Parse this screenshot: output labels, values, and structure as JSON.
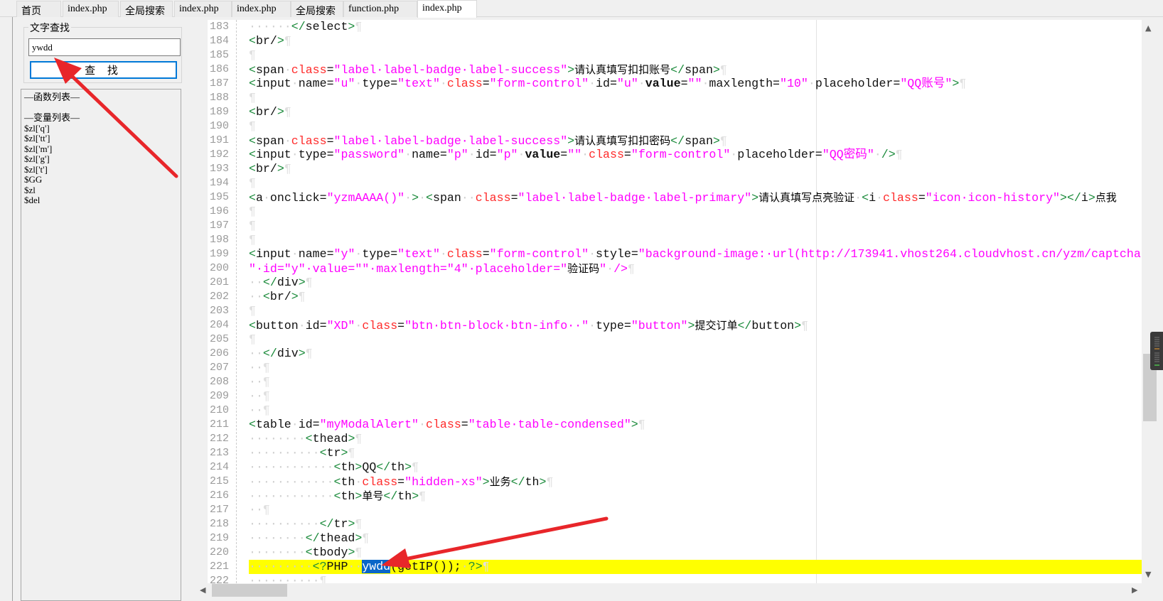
{
  "tabs": [
    {
      "label": "首页"
    },
    {
      "label": "index.php"
    },
    {
      "label": "全局搜索"
    },
    {
      "label": "index.php"
    },
    {
      "label": "index.php"
    },
    {
      "label": "全局搜索"
    },
    {
      "label": "function.php"
    },
    {
      "label": "index.php",
      "active": true
    }
  ],
  "find": {
    "legend": "文字查找",
    "value": "ywdd",
    "button": "查 找"
  },
  "list": [
    "—函数列表—",
    "",
    "—变量列表—",
    "$zl['q']",
    "$zl['tt']",
    "$zl['m']",
    "$zl['g']",
    "$zl['t']",
    "$GG",
    "$zl",
    "$del"
  ],
  "editor": {
    "highlight_line": 221,
    "lines": [
      {
        "n": "183",
        "t": [
          [
            "w",
            "······"
          ],
          [
            "p",
            "</"
          ],
          [
            "n",
            "select"
          ],
          [
            "p",
            ">"
          ],
          [
            "pil",
            "¶"
          ]
        ]
      },
      {
        "n": "184",
        "t": [
          [
            "p",
            "<"
          ],
          [
            "n",
            "br/"
          ],
          [
            "p",
            ">"
          ],
          [
            "pil",
            "¶"
          ]
        ]
      },
      {
        "n": "185",
        "t": [
          [
            "pil",
            "¶"
          ]
        ]
      },
      {
        "n": "186",
        "t": [
          [
            "p",
            "<"
          ],
          [
            "n",
            "span"
          ],
          [
            "w",
            "·"
          ],
          [
            "a",
            "class"
          ],
          [
            "n",
            "="
          ],
          [
            "s",
            "\"label·label-badge·label-success\""
          ],
          [
            "p",
            ">"
          ],
          [
            "c",
            "请认真填写扣扣账号"
          ],
          [
            "p",
            "</"
          ],
          [
            "n",
            "span"
          ],
          [
            "p",
            ">"
          ],
          [
            "pil",
            "¶"
          ]
        ]
      },
      {
        "n": "187",
        "t": [
          [
            "p",
            "<"
          ],
          [
            "n",
            "input"
          ],
          [
            "w",
            "·"
          ],
          [
            "n",
            "name="
          ],
          [
            "s",
            "\"u\""
          ],
          [
            "w",
            "·"
          ],
          [
            "n",
            "type="
          ],
          [
            "s",
            "\"text\""
          ],
          [
            "w",
            "·"
          ],
          [
            "a",
            "class"
          ],
          [
            "n",
            "="
          ],
          [
            "s",
            "\"form-control\""
          ],
          [
            "w",
            "·"
          ],
          [
            "n",
            "id="
          ],
          [
            "s",
            "\"u\""
          ],
          [
            "w",
            "·"
          ],
          [
            "b",
            "value"
          ],
          [
            "n",
            "="
          ],
          [
            "s",
            "\"\""
          ],
          [
            "w",
            "·"
          ],
          [
            "n",
            "maxlength="
          ],
          [
            "s",
            "\"10\""
          ],
          [
            "w",
            "·"
          ],
          [
            "n",
            "placeholder="
          ],
          [
            "s",
            "\"QQ账号\""
          ],
          [
            "p",
            ">"
          ],
          [
            "pil",
            "¶"
          ]
        ]
      },
      {
        "n": "188",
        "t": [
          [
            "pil",
            "¶"
          ]
        ]
      },
      {
        "n": "189",
        "t": [
          [
            "p",
            "<"
          ],
          [
            "n",
            "br/"
          ],
          [
            "p",
            ">"
          ],
          [
            "pil",
            "¶"
          ]
        ]
      },
      {
        "n": "190",
        "t": [
          [
            "pil",
            "¶"
          ]
        ]
      },
      {
        "n": "191",
        "t": [
          [
            "p",
            "<"
          ],
          [
            "n",
            "span"
          ],
          [
            "w",
            "·"
          ],
          [
            "a",
            "class"
          ],
          [
            "n",
            "="
          ],
          [
            "s",
            "\"label·label-badge·label-success\""
          ],
          [
            "p",
            ">"
          ],
          [
            "c",
            "请认真填写扣扣密码"
          ],
          [
            "p",
            "</"
          ],
          [
            "n",
            "span"
          ],
          [
            "p",
            ">"
          ],
          [
            "pil",
            "¶"
          ]
        ]
      },
      {
        "n": "192",
        "t": [
          [
            "p",
            "<"
          ],
          [
            "n",
            "input"
          ],
          [
            "w",
            "·"
          ],
          [
            "n",
            "type="
          ],
          [
            "s",
            "\"password\""
          ],
          [
            "w",
            "·"
          ],
          [
            "n",
            "name="
          ],
          [
            "s",
            "\"p\""
          ],
          [
            "w",
            "·"
          ],
          [
            "n",
            "id="
          ],
          [
            "s",
            "\"p\""
          ],
          [
            "w",
            "·"
          ],
          [
            "b",
            "value"
          ],
          [
            "n",
            "="
          ],
          [
            "s",
            "\"\""
          ],
          [
            "w",
            "·"
          ],
          [
            "a",
            "class"
          ],
          [
            "n",
            "="
          ],
          [
            "s",
            "\"form-control\""
          ],
          [
            "w",
            "·"
          ],
          [
            "n",
            "placeholder="
          ],
          [
            "s",
            "\"QQ密码\""
          ],
          [
            "w",
            "·"
          ],
          [
            "p",
            "/>"
          ],
          [
            "pil",
            "¶"
          ]
        ]
      },
      {
        "n": "193",
        "t": [
          [
            "p",
            "<"
          ],
          [
            "n",
            "br/"
          ],
          [
            "p",
            ">"
          ],
          [
            "pil",
            "¶"
          ]
        ]
      },
      {
        "n": "194",
        "t": [
          [
            "pil",
            "¶"
          ]
        ]
      },
      {
        "n": "195",
        "t": [
          [
            "p",
            "<"
          ],
          [
            "n",
            "a"
          ],
          [
            "w",
            "·"
          ],
          [
            "n",
            "onclick="
          ],
          [
            "s",
            "\"yzmAAAA()\""
          ],
          [
            "w",
            "·"
          ],
          [
            "p",
            ">"
          ],
          [
            "w",
            "·"
          ],
          [
            "p",
            "<"
          ],
          [
            "n",
            "span"
          ],
          [
            "w",
            "··"
          ],
          [
            "a",
            "class"
          ],
          [
            "n",
            "="
          ],
          [
            "s",
            "\"label·label-badge·label-primary\""
          ],
          [
            "p",
            ">"
          ],
          [
            "c",
            "请认真填写点亮验证"
          ],
          [
            "w",
            "·"
          ],
          [
            "p",
            "<"
          ],
          [
            "n",
            "i"
          ],
          [
            "w",
            "·"
          ],
          [
            "a",
            "class"
          ],
          [
            "n",
            "="
          ],
          [
            "s",
            "\"icon·icon-history\""
          ],
          [
            "p",
            "></"
          ],
          [
            "n",
            "i"
          ],
          [
            "p",
            ">"
          ],
          [
            "c",
            "点我"
          ]
        ]
      },
      {
        "n": "196",
        "t": [
          [
            "pil",
            "¶"
          ]
        ]
      },
      {
        "n": "197",
        "t": [
          [
            "pil",
            "¶"
          ]
        ]
      },
      {
        "n": "198",
        "t": [
          [
            "pil",
            "¶"
          ]
        ]
      },
      {
        "n": "199",
        "t": [
          [
            "p",
            "<"
          ],
          [
            "n",
            "input"
          ],
          [
            "w",
            "·"
          ],
          [
            "n",
            "name="
          ],
          [
            "s",
            "\"y\""
          ],
          [
            "w",
            "·"
          ],
          [
            "n",
            "type="
          ],
          [
            "s",
            "\"text\""
          ],
          [
            "w",
            "·"
          ],
          [
            "a",
            "class"
          ],
          [
            "n",
            "="
          ],
          [
            "s",
            "\"form-control\""
          ],
          [
            "w",
            "·"
          ],
          [
            "n",
            "style="
          ],
          [
            "s",
            "\"background-image:·url(http://173941.vhost264.cloudvhost.cn/yzm/captcha"
          ]
        ]
      },
      {
        "n": "200",
        "t": [
          [
            "s",
            "\"·id=\"y\"·value=\"\"·maxlength=\"4\"·placeholder=\""
          ],
          [
            "c",
            "验证码"
          ],
          [
            "s",
            "\""
          ],
          [
            "w",
            "·"
          ],
          [
            "s",
            "/>"
          ],
          [
            "pil",
            "¶"
          ]
        ]
      },
      {
        "n": "201",
        "t": [
          [
            "w",
            "··"
          ],
          [
            "p",
            "</"
          ],
          [
            "n",
            "div"
          ],
          [
            "p",
            ">"
          ],
          [
            "pil",
            "¶"
          ]
        ]
      },
      {
        "n": "202",
        "t": [
          [
            "w",
            "··"
          ],
          [
            "p",
            "<"
          ],
          [
            "n",
            "br/"
          ],
          [
            "p",
            ">"
          ],
          [
            "pil",
            "¶"
          ]
        ]
      },
      {
        "n": "203",
        "t": [
          [
            "pil",
            "¶"
          ]
        ]
      },
      {
        "n": "204",
        "t": [
          [
            "p",
            "<"
          ],
          [
            "n",
            "button"
          ],
          [
            "w",
            "·"
          ],
          [
            "n",
            "id="
          ],
          [
            "s",
            "\"XD\""
          ],
          [
            "w",
            "·"
          ],
          [
            "a",
            "class"
          ],
          [
            "n",
            "="
          ],
          [
            "s",
            "\"btn·btn-block·btn-info··\""
          ],
          [
            "w",
            "·"
          ],
          [
            "n",
            "type="
          ],
          [
            "s",
            "\"button\""
          ],
          [
            "p",
            ">"
          ],
          [
            "c",
            "提交订单"
          ],
          [
            "p",
            "</"
          ],
          [
            "n",
            "button"
          ],
          [
            "p",
            ">"
          ],
          [
            "pil",
            "¶"
          ]
        ]
      },
      {
        "n": "205",
        "t": [
          [
            "pil",
            "¶"
          ]
        ]
      },
      {
        "n": "206",
        "t": [
          [
            "w",
            "··"
          ],
          [
            "p",
            "</"
          ],
          [
            "n",
            "div"
          ],
          [
            "p",
            ">"
          ],
          [
            "pil",
            "¶"
          ]
        ]
      },
      {
        "n": "207",
        "t": [
          [
            "w",
            "··"
          ],
          [
            "pil",
            "¶"
          ]
        ]
      },
      {
        "n": "208",
        "t": [
          [
            "w",
            "··"
          ],
          [
            "pil",
            "¶"
          ]
        ]
      },
      {
        "n": "209",
        "t": [
          [
            "w",
            "··"
          ],
          [
            "pil",
            "¶"
          ]
        ]
      },
      {
        "n": "210",
        "t": [
          [
            "w",
            "··"
          ],
          [
            "pil",
            "¶"
          ]
        ]
      },
      {
        "n": "211",
        "t": [
          [
            "p",
            "<"
          ],
          [
            "n",
            "table"
          ],
          [
            "w",
            "·"
          ],
          [
            "n",
            "id="
          ],
          [
            "s",
            "\"myModalAlert\""
          ],
          [
            "w",
            "·"
          ],
          [
            "a",
            "class"
          ],
          [
            "n",
            "="
          ],
          [
            "s",
            "\"table·table-condensed\""
          ],
          [
            "p",
            ">"
          ],
          [
            "pil",
            "¶"
          ]
        ]
      },
      {
        "n": "212",
        "t": [
          [
            "w",
            "········"
          ],
          [
            "p",
            "<"
          ],
          [
            "n",
            "thead"
          ],
          [
            "p",
            ">"
          ],
          [
            "pil",
            "¶"
          ]
        ]
      },
      {
        "n": "213",
        "t": [
          [
            "w",
            "··········"
          ],
          [
            "p",
            "<"
          ],
          [
            "n",
            "tr"
          ],
          [
            "p",
            ">"
          ],
          [
            "pil",
            "¶"
          ]
        ]
      },
      {
        "n": "214",
        "t": [
          [
            "w",
            "············"
          ],
          [
            "p",
            "<"
          ],
          [
            "n",
            "th"
          ],
          [
            "p",
            ">"
          ],
          [
            "n",
            "QQ"
          ],
          [
            "p",
            "</"
          ],
          [
            "n",
            "th"
          ],
          [
            "p",
            ">"
          ],
          [
            "pil",
            "¶"
          ]
        ]
      },
      {
        "n": "215",
        "t": [
          [
            "w",
            "············"
          ],
          [
            "p",
            "<"
          ],
          [
            "n",
            "th"
          ],
          [
            "w",
            "·"
          ],
          [
            "a",
            "class"
          ],
          [
            "n",
            "="
          ],
          [
            "s",
            "\"hidden-xs\""
          ],
          [
            "p",
            ">"
          ],
          [
            "c",
            "业务"
          ],
          [
            "p",
            "</"
          ],
          [
            "n",
            "th"
          ],
          [
            "p",
            ">"
          ],
          [
            "pil",
            "¶"
          ]
        ]
      },
      {
        "n": "216",
        "t": [
          [
            "w",
            "············"
          ],
          [
            "p",
            "<"
          ],
          [
            "n",
            "th"
          ],
          [
            "p",
            ">"
          ],
          [
            "c",
            "单号"
          ],
          [
            "p",
            "</"
          ],
          [
            "n",
            "th"
          ],
          [
            "p",
            ">"
          ],
          [
            "pil",
            "¶"
          ]
        ]
      },
      {
        "n": "217",
        "t": [
          [
            "w",
            "··"
          ],
          [
            "pil",
            "¶"
          ]
        ]
      },
      {
        "n": "218",
        "t": [
          [
            "w",
            "··········"
          ],
          [
            "p",
            "</"
          ],
          [
            "n",
            "tr"
          ],
          [
            "p",
            ">"
          ],
          [
            "pil",
            "¶"
          ]
        ]
      },
      {
        "n": "219",
        "t": [
          [
            "w",
            "········"
          ],
          [
            "p",
            "</"
          ],
          [
            "n",
            "thead"
          ],
          [
            "p",
            ">"
          ],
          [
            "pil",
            "¶"
          ]
        ]
      },
      {
        "n": "220",
        "t": [
          [
            "w",
            "········"
          ],
          [
            "p",
            "<"
          ],
          [
            "n",
            "tbody"
          ],
          [
            "p",
            ">"
          ],
          [
            "pil",
            "¶"
          ]
        ]
      },
      {
        "n": "221",
        "t": [
          [
            "w",
            "·········"
          ],
          [
            "p",
            "<?"
          ],
          [
            "n",
            "PHP"
          ],
          [
            "w",
            "··"
          ],
          [
            "sel",
            "ywdd"
          ],
          [
            "n",
            "(getIP());"
          ],
          [
            "w",
            "·"
          ],
          [
            "p",
            "?>"
          ],
          [
            "pil",
            "¶"
          ]
        ]
      },
      {
        "n": "222",
        "t": [
          [
            "w",
            "··········"
          ],
          [
            "pil",
            "¶"
          ]
        ]
      }
    ]
  },
  "colors": {
    "highlight": "#ffff00",
    "selection": "#0a66c8",
    "arrow": "#e8262a",
    "accent": "#0078d7"
  }
}
